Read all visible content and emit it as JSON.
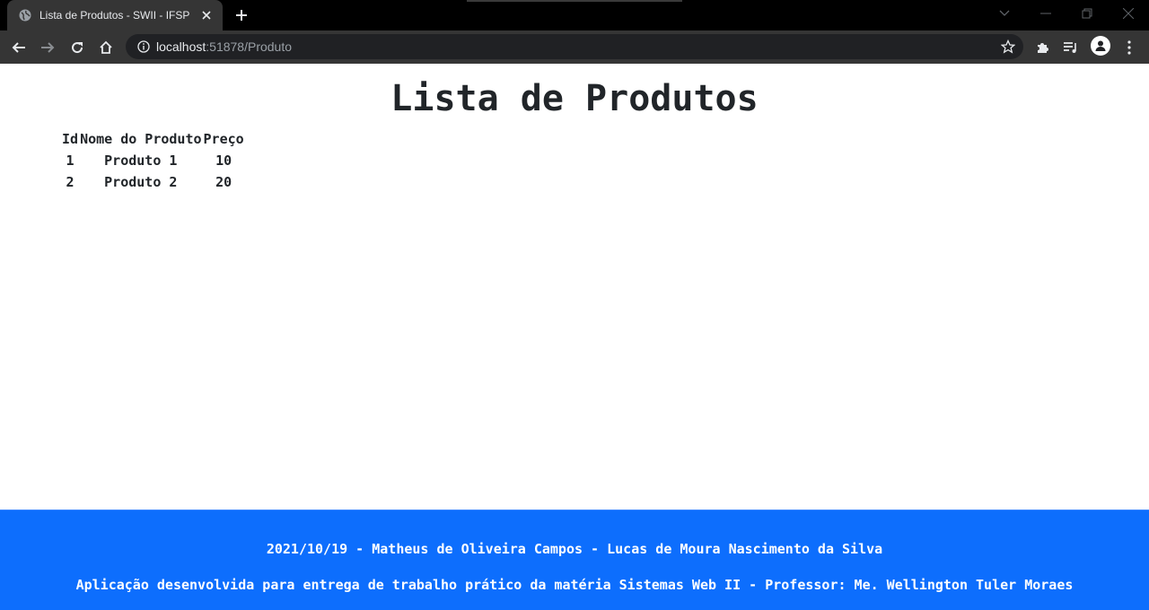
{
  "browser": {
    "tab_title": "Lista de Produtos - SWII - IFSP",
    "url_host": "localhost",
    "url_rest": ":51878/Produto"
  },
  "page": {
    "title": "Lista de Produtos",
    "table": {
      "headers": [
        "Id",
        "Nome do Produto",
        "Preço"
      ],
      "rows": [
        [
          "1",
          "Produto 1",
          "10"
        ],
        [
          "2",
          "Produto 2",
          "20"
        ]
      ]
    }
  },
  "footer": {
    "line1": "2021/10/19 - Matheus de Oliveira Campos - Lucas de Moura Nascimento da Silva",
    "line2": "Aplicação desenvolvida para entrega de trabalho prático da matéria Sistemas Web II - Professor: Me. Wellington Tuler Moraes"
  },
  "colors": {
    "footer_bg": "#0d6efd",
    "chrome_bg": "#353535",
    "tabbar_bg": "#000000"
  }
}
